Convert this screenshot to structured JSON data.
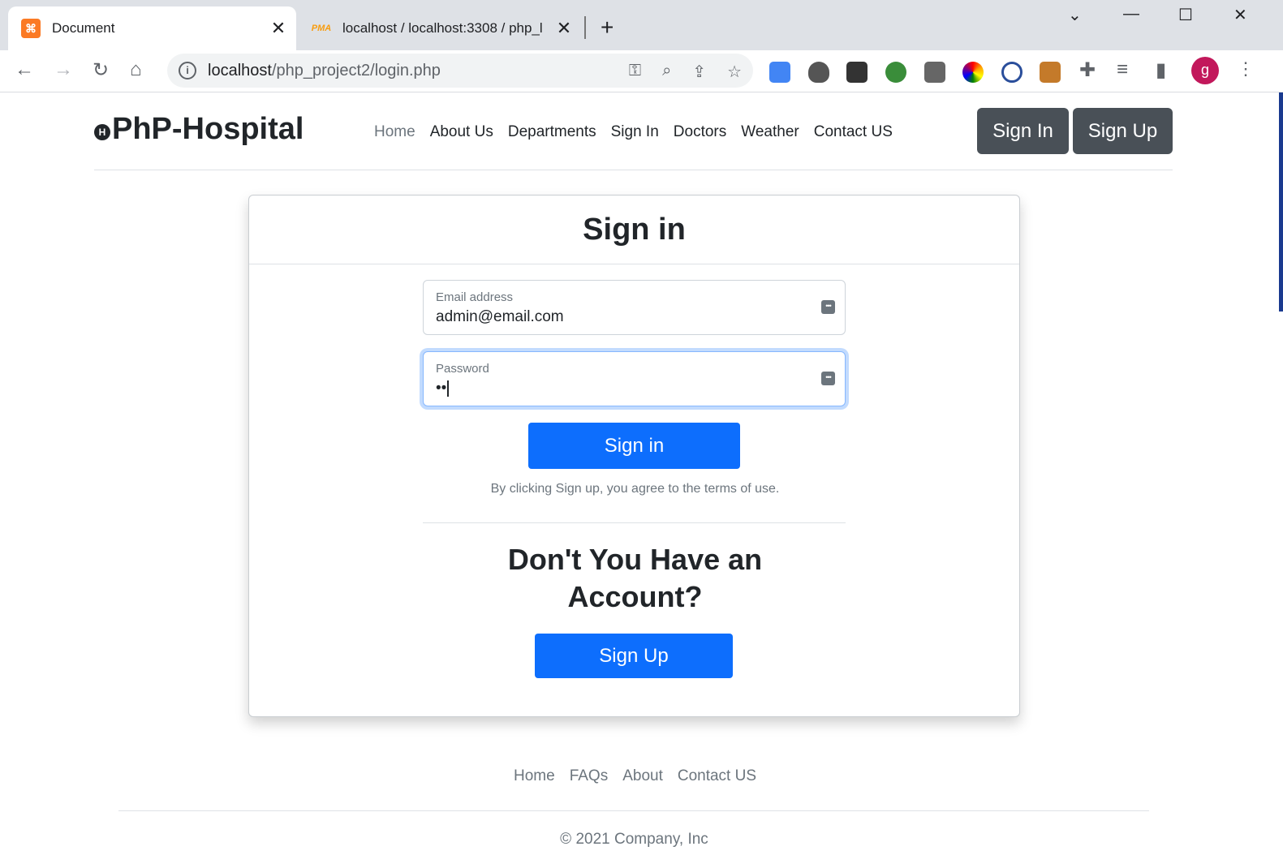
{
  "browser": {
    "tabs": [
      {
        "title": "Document",
        "active": true,
        "icon": "xampp-icon"
      },
      {
        "title": "localhost / localhost:3308 / php_l",
        "active": false,
        "icon": "phpmyadmin-icon"
      }
    ],
    "url_host": "localhost",
    "url_path": "/php_project2/login.php",
    "avatar_letter": "g"
  },
  "header": {
    "brand": "PhP-Hospital",
    "brand_logo": "H",
    "nav": [
      {
        "label": "Home",
        "active": true
      },
      {
        "label": "About Us"
      },
      {
        "label": "Departments"
      },
      {
        "label": "Sign In"
      },
      {
        "label": "Doctors"
      },
      {
        "label": "Weather"
      },
      {
        "label": "Contact US"
      }
    ],
    "signin_button": "Sign In",
    "signup_button": "Sign Up"
  },
  "card": {
    "title": "Sign in",
    "email": {
      "label": "Email address",
      "value": "admin@email.com"
    },
    "password": {
      "label": "Password",
      "value": "••"
    },
    "submit": "Sign in",
    "terms": "By clicking Sign up, you agree to the terms of use.",
    "question": "Don't You Have an Account?",
    "signup": "Sign Up"
  },
  "footer": {
    "nav": [
      "Home",
      "FAQs",
      "About",
      "Contact US"
    ],
    "copyright": "© 2021 Company, Inc"
  },
  "colors": {
    "primary": "#0d6efd",
    "secondary": "#495057",
    "text": "#212529",
    "muted": "#6c757d"
  }
}
